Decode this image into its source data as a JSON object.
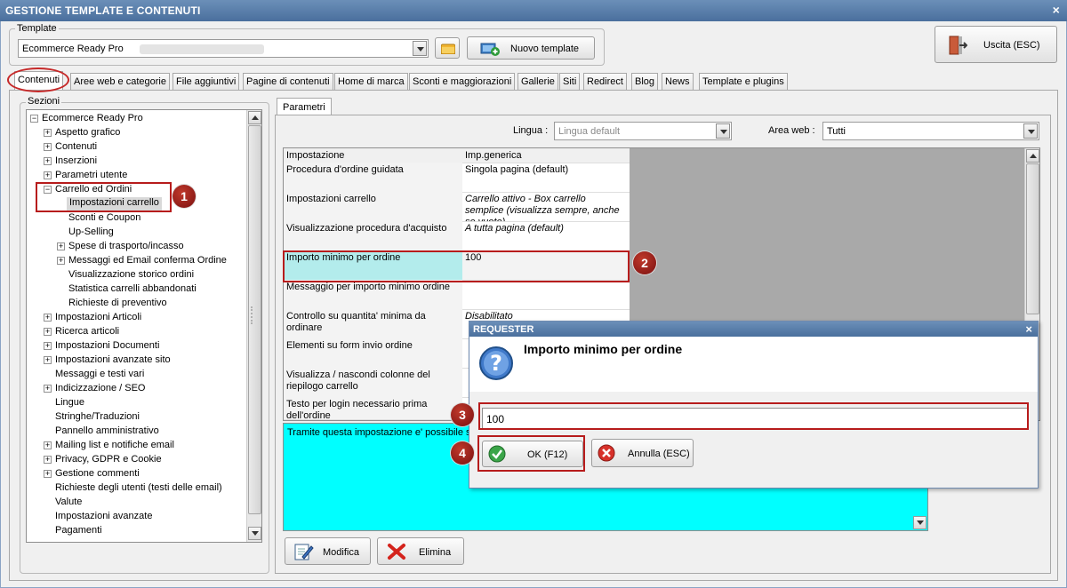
{
  "window": {
    "title": "GESTIONE TEMPLATE E CONTENUTI",
    "close": "×"
  },
  "template": {
    "group_label": "Template",
    "selected": "Ecommerce Ready Pro",
    "new_button": "Nuovo template"
  },
  "exit_button": "Uscita (ESC)",
  "tabs": [
    "Contenuti",
    "Aree web e categorie",
    "File aggiuntivi",
    "Pagine di contenuti",
    "Home di marca",
    "Sconti e maggiorazioni",
    "Gallerie",
    "Siti",
    "Redirect",
    "Blog",
    "News",
    "Template e plugins"
  ],
  "sections": {
    "label": "Sezioni",
    "items": [
      "Ecommerce Ready Pro",
      "Aspetto grafico",
      "Contenuti",
      "Inserzioni",
      "Parametri utente",
      "Carrello ed Ordini",
      "Impostazioni carrello",
      "Sconti e Coupon",
      "Up-Selling",
      "Spese di trasporto/incasso",
      "Messaggi ed Email conferma Ordine",
      "Visualizzazione storico ordini",
      "Statistica carrelli abbandonati",
      "Richieste di preventivo",
      "Impostazioni Articoli",
      "Ricerca articoli",
      "Impostazioni Documenti",
      "Impostazioni avanzate sito",
      "Messaggi e testi vari",
      "Indicizzazione / SEO",
      "Lingue",
      "Stringhe/Traduzioni",
      "Pannello amministrativo",
      "Mailing list e notifiche email",
      "Privacy, GDPR e Cookie",
      "Gestione commenti",
      "Richieste degli utenti (testi delle email)",
      "Valute",
      "Impostazioni avanzate",
      "Pagamenti"
    ]
  },
  "parametri": {
    "tab": "Parametri",
    "lingua_label": "Lingua :",
    "lingua_value": "Lingua default",
    "area_label": "Area web :",
    "area_value": "Tutti",
    "headers": [
      "Impostazione",
      "Imp.generica"
    ],
    "rows": [
      [
        "Procedura d'ordine guidata",
        "Singola pagina (default)"
      ],
      [
        "Impostazioni carrello",
        "Carrello attivo - Box carrello semplice (visualizza sempre, anche se vuoto)"
      ],
      [
        "Visualizzazione procedura d'acquisto",
        "A tutta pagina (default)"
      ],
      [
        "Importo minimo per ordine",
        "100"
      ],
      [
        "Messaggio per importo minimo ordine",
        ""
      ],
      [
        "Controllo su quantita' minima da ordinare",
        "Disabilitato"
      ],
      [
        "Elementi su form invio ordine",
        ""
      ],
      [
        "Visualizza / nascondi colonne del riepilogo carrello",
        ""
      ],
      [
        "Testo per login necessario prima dell'ordine",
        ""
      ]
    ],
    "description": "Tramite questa impostazione e' possibile sp",
    "modifica": "Modifica",
    "elimina": "Elimina"
  },
  "dialog": {
    "title": "REQUESTER",
    "close": "×",
    "heading": "Importo minimo per ordine",
    "value": "100",
    "ok": "OK (F12)",
    "cancel": "Annulla (ESC)"
  },
  "badges": [
    "1",
    "2",
    "3",
    "4"
  ],
  "colors": {
    "title_bar": "#5a7fab",
    "highlight_cell": "#b3ecec",
    "description_bg": "#00ffff",
    "annotation_red": "#b71c1c",
    "tree_selected": "#d9d9d9"
  }
}
